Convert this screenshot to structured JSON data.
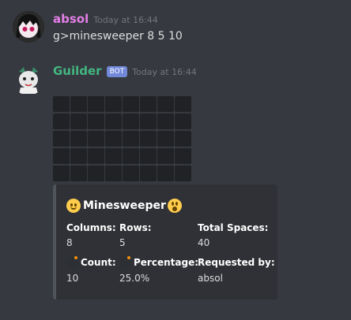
{
  "messages": [
    {
      "author": "absol",
      "author_color": "#e27ee5",
      "timestamp": "Today at 16:44",
      "text": "g>minesweeper 8 5 10"
    },
    {
      "author": "Guilder",
      "author_color": "#43b581",
      "bot_tag": "BOT",
      "timestamp": "Today at 16:44"
    }
  ],
  "minesweeper": {
    "columns": 8,
    "rows": 5
  },
  "embed": {
    "title": "Minesweeper",
    "title_emoji_left": "slightly-smiling-face-icon",
    "title_emoji_right": "astonished-face-icon",
    "fields": [
      {
        "name": "Columns:",
        "value": "8"
      },
      {
        "name": "Rows:",
        "value": "5"
      },
      {
        "name": "Total Spaces:",
        "value": "40"
      },
      {
        "name": "Count:",
        "value": "10",
        "icon": "bomb-icon"
      },
      {
        "name": "Percentage:",
        "value": "25.0%",
        "icon": "bomb-icon"
      },
      {
        "name": "Requested by:",
        "value": "absol"
      }
    ]
  },
  "colors": {
    "background": "#36393f",
    "embed_background": "#2f3136",
    "spoiler_cell": "#202225",
    "bot_tag": "#7289da"
  }
}
